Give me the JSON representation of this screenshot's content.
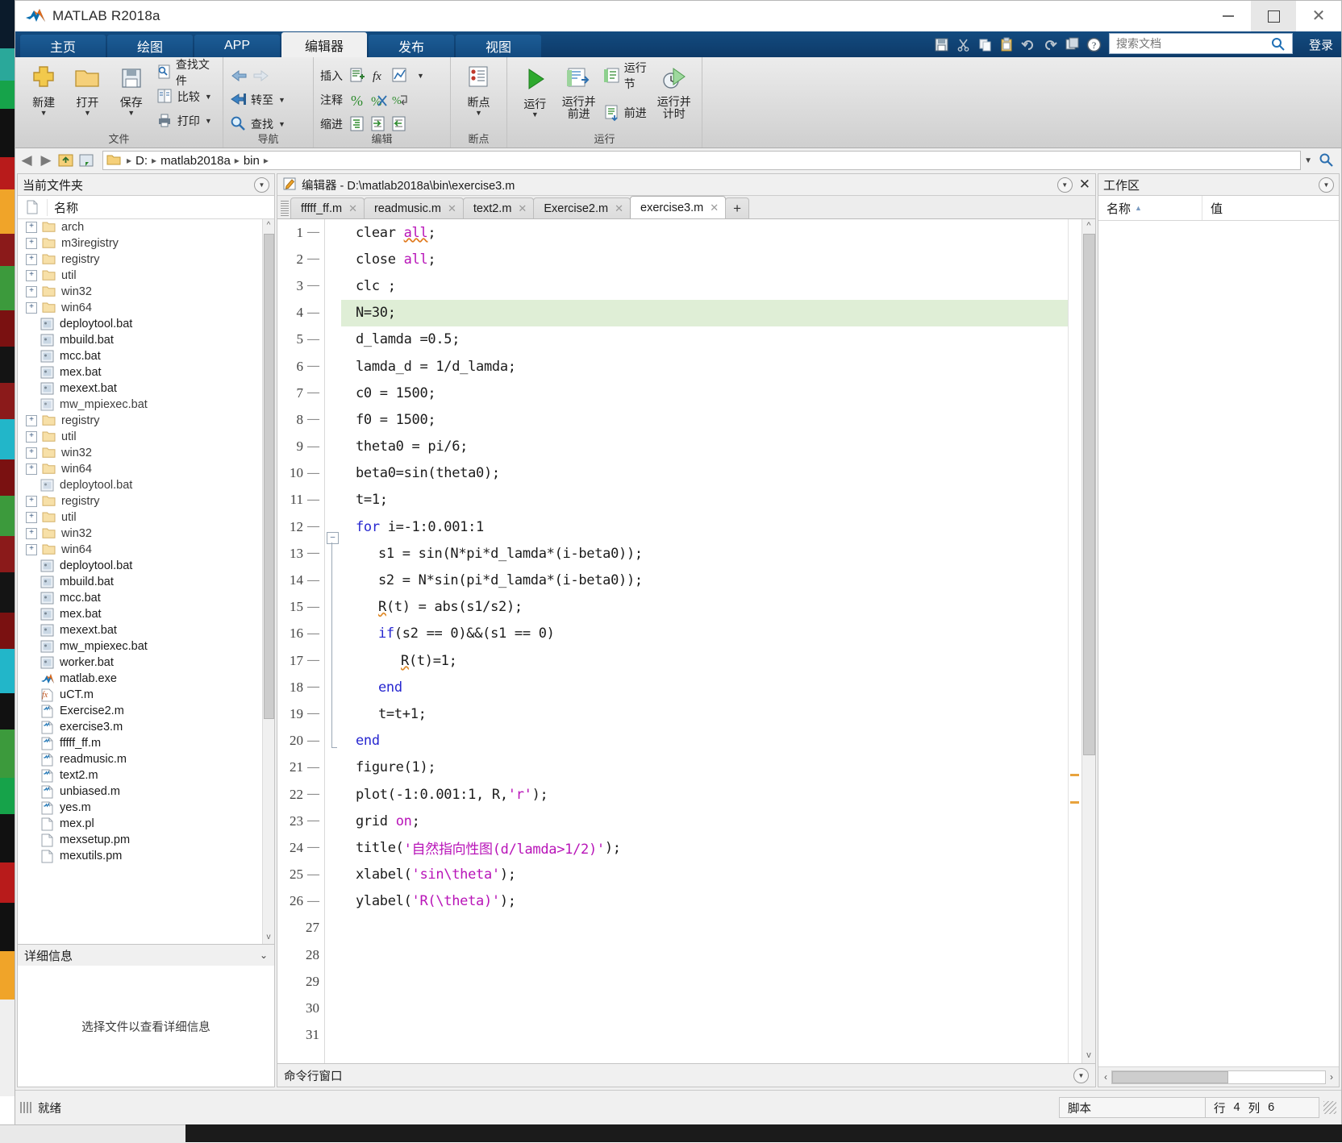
{
  "window": {
    "title": "MATLAB R2018a",
    "logo_icon": "matlab-logo-icon",
    "minimize_label": "—",
    "maximize_label": "□",
    "close_label": "✕"
  },
  "ribbon": {
    "tabs": [
      {
        "label": "主页",
        "active": false
      },
      {
        "label": "绘图",
        "active": false
      },
      {
        "label": "APP",
        "active": false
      },
      {
        "label": "编辑器",
        "active": true
      },
      {
        "label": "发布",
        "active": false
      },
      {
        "label": "视图",
        "active": false
      }
    ],
    "quick_access": [
      {
        "name": "save-icon",
        "glyph": "save"
      },
      {
        "name": "cut-icon",
        "glyph": "cut"
      },
      {
        "name": "copy-icon",
        "glyph": "copy"
      },
      {
        "name": "paste-icon",
        "glyph": "paste"
      },
      {
        "name": "undo-icon",
        "glyph": "undo"
      },
      {
        "name": "redo-icon",
        "glyph": "redo"
      },
      {
        "name": "switch-window-icon",
        "glyph": "switch"
      },
      {
        "name": "help-icon",
        "glyph": "help"
      },
      {
        "name": "qat-dropdown-icon",
        "glyph": "caret"
      }
    ],
    "search": {
      "placeholder": "搜索文档",
      "value": ""
    },
    "login_label": "登录",
    "groups": [
      {
        "name": "文件",
        "big_buttons": [
          {
            "label": "新建",
            "icon": "new-file-icon",
            "has_caret": true
          },
          {
            "label": "打开",
            "icon": "open-folder-icon",
            "has_caret": true
          },
          {
            "label": "保存",
            "icon": "save-disk-icon",
            "has_caret": true
          }
        ],
        "small_buttons": [
          {
            "label": "查找文件",
            "icon": "find-files-icon",
            "has_caret": false
          },
          {
            "label": "比较",
            "icon": "compare-icon",
            "has_caret": true
          },
          {
            "label": "打印",
            "icon": "print-icon",
            "has_caret": true
          }
        ]
      },
      {
        "name": "导航",
        "small_buttons": [
          {
            "label": "",
            "icon": "back-arrow-icon",
            "has_caret": false
          },
          {
            "label": "",
            "icon": "forward-arrow-icon",
            "has_caret": false
          },
          {
            "label": "转至",
            "icon": "goto-icon",
            "has_caret": true
          },
          {
            "label": "查找",
            "icon": "search-magnifier-icon",
            "has_caret": true
          }
        ]
      },
      {
        "name": "编辑",
        "rows": [
          {
            "label": "插入",
            "icons": [
              "insert-block-icon",
              "insert-function-icon",
              "insert-plot-icon"
            ],
            "has_caret": true
          },
          {
            "label": "注释",
            "icons": [
              "comment-percent-icon",
              "uncomment-icon",
              "wrap-comment-icon"
            ],
            "has_caret": false
          },
          {
            "label": "缩进",
            "icons": [
              "smart-indent-icon",
              "indent-right-icon",
              "indent-left-icon"
            ],
            "has_caret": false
          }
        ]
      },
      {
        "name": "断点",
        "big_buttons": [
          {
            "label": "断点",
            "icon": "breakpoint-icon",
            "has_caret": true
          }
        ]
      },
      {
        "name": "运行",
        "big_buttons": [
          {
            "label": "运行",
            "icon": "run-icon",
            "has_caret": true
          },
          {
            "label": "运行并\n前进",
            "icon": "run-advance-icon",
            "has_caret": false
          },
          {
            "label": "运行并\n计时",
            "icon": "run-time-icon",
            "has_caret": false
          }
        ],
        "small_buttons": [
          {
            "label": "运行节",
            "icon": "run-section-icon"
          },
          {
            "label": "前进",
            "icon": "advance-icon"
          }
        ]
      }
    ]
  },
  "address_bar": {
    "back_icon": "back-arrow-icon",
    "forward_icon": "forward-arrow-icon",
    "up_icon": "up-folder-icon",
    "browse_icon": "browse-folder-icon",
    "folder_icon": "folder-icon",
    "crumbs": [
      "D:",
      "matlab2018a",
      "bin"
    ],
    "dropdown_icon": "chevron-down-icon",
    "search_icon": "search-magnifier-icon"
  },
  "current_folder": {
    "title": "当前文件夹",
    "collapse_icon": "panel-menu-icon",
    "column_name": "名称",
    "file_icon_header": "file-icon",
    "items": [
      {
        "name": "arch",
        "type": "folder",
        "expandable": true
      },
      {
        "name": "m3iregistry",
        "type": "folder",
        "expandable": true
      },
      {
        "name": "registry",
        "type": "folder",
        "expandable": true
      },
      {
        "name": "util",
        "type": "folder",
        "expandable": true
      },
      {
        "name": "win32",
        "type": "folder",
        "expandable": true
      },
      {
        "name": "win64",
        "type": "folder",
        "expandable": true
      },
      {
        "name": "deploytool.bat",
        "type": "bat",
        "expandable": false
      },
      {
        "name": "mbuild.bat",
        "type": "bat",
        "expandable": false
      },
      {
        "name": "mcc.bat",
        "type": "bat",
        "expandable": false
      },
      {
        "name": "mex.bat",
        "type": "bat",
        "expandable": false
      },
      {
        "name": "mexext.bat",
        "type": "bat",
        "expandable": false
      },
      {
        "name": "mw_mpiexec.bat",
        "type": "bat",
        "expandable": false,
        "glitch": true
      },
      {
        "name": "registry",
        "type": "folder",
        "expandable": true
      },
      {
        "name": "util",
        "type": "folder",
        "expandable": true
      },
      {
        "name": "win32",
        "type": "folder",
        "expandable": true
      },
      {
        "name": "win64",
        "type": "folder",
        "expandable": true
      },
      {
        "name": "deploytool.bat",
        "type": "bat",
        "expandable": false,
        "glitch": true
      },
      {
        "name": "registry",
        "type": "folder",
        "expandable": true
      },
      {
        "name": "util",
        "type": "folder",
        "expandable": true
      },
      {
        "name": "win32",
        "type": "folder",
        "expandable": true
      },
      {
        "name": "win64",
        "type": "folder",
        "expandable": true
      },
      {
        "name": "deploytool.bat",
        "type": "bat",
        "expandable": false
      },
      {
        "name": "mbuild.bat",
        "type": "bat",
        "expandable": false
      },
      {
        "name": "mcc.bat",
        "type": "bat",
        "expandable": false
      },
      {
        "name": "mex.bat",
        "type": "bat",
        "expandable": false
      },
      {
        "name": "mexext.bat",
        "type": "bat",
        "expandable": false
      },
      {
        "name": "mw_mpiexec.bat",
        "type": "bat",
        "expandable": false
      },
      {
        "name": "worker.bat",
        "type": "bat",
        "expandable": false
      },
      {
        "name": "matlab.exe",
        "type": "exe",
        "expandable": false
      },
      {
        "name": "uCT.m",
        "type": "fx",
        "expandable": false
      },
      {
        "name": "Exercise2.m",
        "type": "m",
        "expandable": false
      },
      {
        "name": "exercise3.m",
        "type": "m",
        "expandable": false
      },
      {
        "name": "fffff_ff.m",
        "type": "m",
        "expandable": false
      },
      {
        "name": "readmusic.m",
        "type": "m",
        "expandable": false
      },
      {
        "name": "text2.m",
        "type": "m",
        "expandable": false
      },
      {
        "name": "unbiased.m",
        "type": "m",
        "expandable": false
      },
      {
        "name": "yes.m",
        "type": "m",
        "expandable": false
      },
      {
        "name": "mex.pl",
        "type": "plain",
        "expandable": false
      },
      {
        "name": "mexsetup.pm",
        "type": "plain",
        "expandable": false
      },
      {
        "name": "mexutils.pm",
        "type": "plain",
        "expandable": false
      }
    ],
    "details": {
      "title": "详细信息",
      "chevron_icon": "chevron-down-icon",
      "empty_text": "选择文件以查看详细信息"
    }
  },
  "editor": {
    "header_icon": "editor-pencil-icon",
    "header_title": "编辑器 - D:\\matlab2018a\\bin\\exercise3.m",
    "panel_menu_icon": "panel-menu-icon",
    "close_icon": "close-icon",
    "tabs": [
      {
        "label": "fffff_ff.m",
        "active": false,
        "close_icon": "close-icon"
      },
      {
        "label": "readmusic.m",
        "active": false,
        "close_icon": "close-icon"
      },
      {
        "label": "text2.m",
        "active": false,
        "close_icon": "close-icon"
      },
      {
        "label": "Exercise2.m",
        "active": false,
        "close_icon": "close-icon"
      },
      {
        "label": "exercise3.m",
        "active": true,
        "close_icon": "close-icon"
      }
    ],
    "new_tab_label": "+",
    "highlight_line": 4,
    "lines": [
      {
        "n": 1,
        "exec": true,
        "tokens": [
          {
            "t": "clear ",
            "c": "plain"
          },
          {
            "t": "all",
            "c": "kw-magenta-underline"
          },
          {
            "t": ";",
            "c": "plain"
          }
        ]
      },
      {
        "n": 2,
        "exec": true,
        "tokens": [
          {
            "t": "close ",
            "c": "plain"
          },
          {
            "t": "all",
            "c": "magenta"
          },
          {
            "t": ";",
            "c": "plain"
          }
        ]
      },
      {
        "n": 3,
        "exec": true,
        "tokens": [
          {
            "t": "clc ;",
            "c": "plain"
          }
        ]
      },
      {
        "n": 4,
        "exec": true,
        "tokens": [
          {
            "t": "N=30;",
            "c": "plain"
          }
        ]
      },
      {
        "n": 5,
        "exec": true,
        "tokens": [
          {
            "t": "d_lamda =0.5;",
            "c": "plain"
          }
        ]
      },
      {
        "n": 6,
        "exec": true,
        "tokens": [
          {
            "t": "lamda_d = 1/d_lamda;",
            "c": "plain"
          }
        ]
      },
      {
        "n": 7,
        "exec": true,
        "tokens": [
          {
            "t": "c0 = 1500;",
            "c": "plain"
          }
        ]
      },
      {
        "n": 8,
        "exec": true,
        "tokens": [
          {
            "t": "f0 = 1500;",
            "c": "plain"
          }
        ]
      },
      {
        "n": 9,
        "exec": true,
        "tokens": [
          {
            "t": "theta0 = pi/6;",
            "c": "plain"
          }
        ]
      },
      {
        "n": 10,
        "exec": true,
        "tokens": [
          {
            "t": "beta0=sin(theta0);",
            "c": "plain"
          }
        ]
      },
      {
        "n": 11,
        "exec": true,
        "tokens": [
          {
            "t": "t=1;",
            "c": "plain"
          }
        ]
      },
      {
        "n": 12,
        "exec": true,
        "fold": "start",
        "tokens": [
          {
            "t": "for",
            "c": "kw"
          },
          {
            "t": " i=-1:0.001:1",
            "c": "plain"
          }
        ]
      },
      {
        "n": 13,
        "exec": true,
        "indent": 1,
        "tokens": [
          {
            "t": "s1 = sin(N*pi*d_lamda*(i-beta0));",
            "c": "plain"
          }
        ]
      },
      {
        "n": 14,
        "exec": true,
        "indent": 1,
        "tokens": [
          {
            "t": "s2 = N*sin(pi*d_lamda*(i-beta0));",
            "c": "plain"
          }
        ]
      },
      {
        "n": 15,
        "exec": true,
        "indent": 1,
        "tokens": [
          {
            "t": "R",
            "c": "plain-wavy"
          },
          {
            "t": "(t) = abs(s1/s2);",
            "c": "plain"
          }
        ]
      },
      {
        "n": 16,
        "exec": true,
        "indent": 1,
        "tokens": [
          {
            "t": "if",
            "c": "kw"
          },
          {
            "t": "(s2 == 0)&&(s1 == 0)",
            "c": "plain"
          }
        ]
      },
      {
        "n": 17,
        "exec": true,
        "indent": 2,
        "tokens": [
          {
            "t": "R",
            "c": "plain-wavy"
          },
          {
            "t": "(t)=1;",
            "c": "plain"
          }
        ]
      },
      {
        "n": 18,
        "exec": true,
        "indent": 1,
        "tokens": [
          {
            "t": "end",
            "c": "kw"
          }
        ]
      },
      {
        "n": 19,
        "exec": true,
        "indent": 1,
        "tokens": [
          {
            "t": "t=t+1;",
            "c": "plain"
          }
        ]
      },
      {
        "n": 20,
        "exec": true,
        "fold": "end",
        "tokens": [
          {
            "t": "end",
            "c": "kw"
          }
        ]
      },
      {
        "n": 21,
        "exec": true,
        "tokens": [
          {
            "t": "figure(1);",
            "c": "plain"
          }
        ]
      },
      {
        "n": 22,
        "exec": true,
        "tokens": [
          {
            "t": "plot(-1:0.001:1, R,",
            "c": "plain"
          },
          {
            "t": "'r'",
            "c": "magenta"
          },
          {
            "t": ");",
            "c": "plain"
          }
        ]
      },
      {
        "n": 23,
        "exec": true,
        "tokens": [
          {
            "t": "grid ",
            "c": "plain"
          },
          {
            "t": "on",
            "c": "magenta"
          },
          {
            "t": ";",
            "c": "plain"
          }
        ]
      },
      {
        "n": 24,
        "exec": true,
        "tokens": [
          {
            "t": "title(",
            "c": "plain"
          },
          {
            "t": "'自然指向性图(d/lamda>1/2)'",
            "c": "magenta"
          },
          {
            "t": ");",
            "c": "plain"
          }
        ]
      },
      {
        "n": 25,
        "exec": true,
        "tokens": [
          {
            "t": "xlabel(",
            "c": "plain"
          },
          {
            "t": "'sin\\theta'",
            "c": "magenta"
          },
          {
            "t": ");",
            "c": "plain"
          }
        ]
      },
      {
        "n": 26,
        "exec": true,
        "tokens": [
          {
            "t": "ylabel(",
            "c": "plain"
          },
          {
            "t": "'R(\\theta)'",
            "c": "magenta"
          },
          {
            "t": ");",
            "c": "plain"
          }
        ]
      },
      {
        "n": 27,
        "exec": false,
        "tokens": []
      },
      {
        "n": 28,
        "exec": false,
        "tokens": []
      },
      {
        "n": 29,
        "exec": false,
        "tokens": []
      },
      {
        "n": 30,
        "exec": false,
        "tokens": []
      },
      {
        "n": 31,
        "exec": false,
        "tokens": []
      }
    ],
    "command_window": {
      "title": "命令行窗口",
      "panel_menu_icon": "panel-menu-icon"
    }
  },
  "workspace": {
    "title": "工作区",
    "panel_menu_icon": "panel-menu-icon",
    "columns": [
      "名称",
      "值"
    ],
    "sort_icon": "sort-ascending-icon",
    "rows": []
  },
  "status_bar": {
    "ready_label": "就绪",
    "file_type": "脚本",
    "line_label": "行",
    "line_value": "4",
    "col_label": "列",
    "col_value": "6"
  },
  "colors": {
    "ribbon_blue": "#0e3e6e",
    "active_line_green": "#dfeed6",
    "keyword_blue": "#2727d0",
    "string_magenta": "#b814b8",
    "warning_orange": "#e8a33d"
  }
}
